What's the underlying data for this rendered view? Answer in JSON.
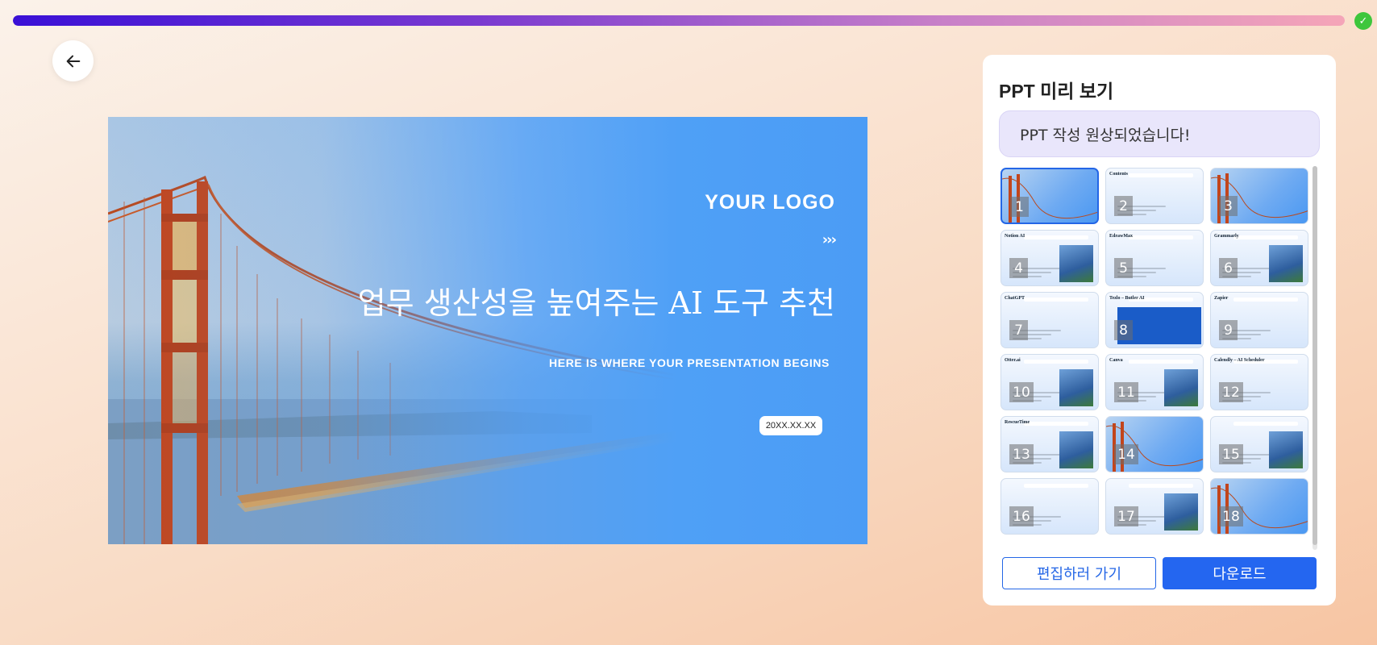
{
  "progress": {
    "percent": 100,
    "status": "complete"
  },
  "nav": {
    "back_icon": "arrow-left-icon"
  },
  "slide": {
    "logo": "YOUR LOGO",
    "arrows": "›››",
    "title": "업무 생산성을 높여주는 AI 도구 추천",
    "subtitle": "HERE IS WHERE YOUR PRESENTATION BEGINS",
    "date": "20XX.XX.XX"
  },
  "panel": {
    "title": "PPT 미리 보기",
    "message": "PPT 작성 원상되었습니다!",
    "thumbnails": [
      {
        "num": "1",
        "header": "",
        "selected": true
      },
      {
        "num": "2",
        "header": "Contents"
      },
      {
        "num": "3",
        "header": ""
      },
      {
        "num": "4",
        "header": "Notion AI"
      },
      {
        "num": "5",
        "header": "EdrawMax"
      },
      {
        "num": "6",
        "header": "Grammarly"
      },
      {
        "num": "7",
        "header": "ChatGPT"
      },
      {
        "num": "8",
        "header": "Tezlo – Butler AI"
      },
      {
        "num": "9",
        "header": "Zapier"
      },
      {
        "num": "10",
        "header": "Otter.ai"
      },
      {
        "num": "11",
        "header": "Canva"
      },
      {
        "num": "12",
        "header": "Calendly – AI Scheduler"
      },
      {
        "num": "13",
        "header": "RescueTime"
      },
      {
        "num": "14",
        "header": ""
      },
      {
        "num": "15",
        "header": ""
      },
      {
        "num": "16",
        "header": ""
      },
      {
        "num": "17",
        "header": ""
      },
      {
        "num": "18",
        "header": ""
      }
    ],
    "edit_label": "편집하러 가기",
    "download_label": "다운로드"
  },
  "colors": {
    "accent": "#2466f0",
    "progress_start": "#3a10d6",
    "progress_end": "#f5a5b8",
    "check": "#3ec63c"
  }
}
